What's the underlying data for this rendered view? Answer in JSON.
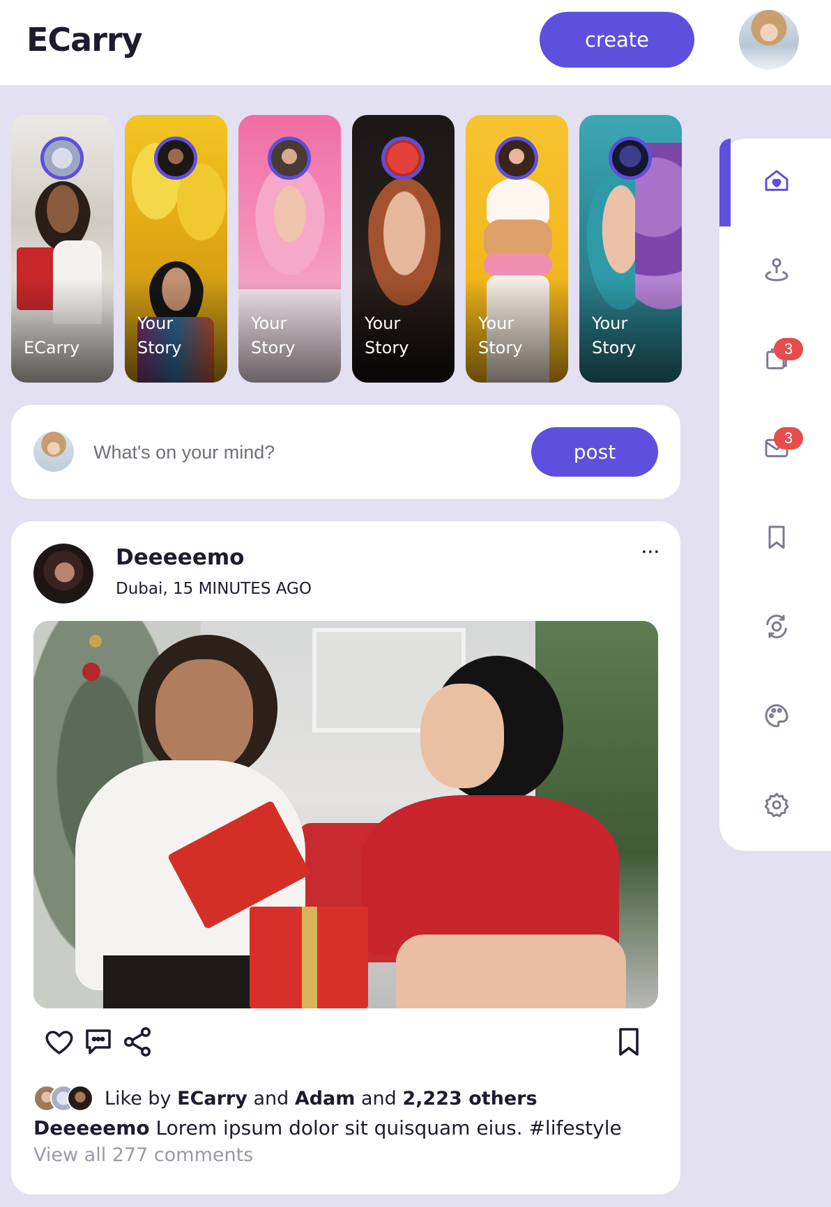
{
  "header": {
    "brand": "ECarry",
    "create_label": "create"
  },
  "stories": [
    {
      "label": "ECarry"
    },
    {
      "label": "Your\nStory"
    },
    {
      "label": "Your\nStory"
    },
    {
      "label": "Your\nStory"
    },
    {
      "label": "Your\nStory"
    },
    {
      "label": "Your\nStory"
    }
  ],
  "composer": {
    "placeholder": "What's on your mind?",
    "post_label": "post"
  },
  "post": {
    "author": "Deeeeemo",
    "meta": "Dubai, 15 MINUTES AGO",
    "more": "···",
    "likes": {
      "prefix": "Like by",
      "user1": "ECarry",
      "and1": "and",
      "user2": "Adam",
      "and2": "and",
      "others": "2,223 others"
    },
    "caption_author": "Deeeeemo",
    "caption_text": "Lorem ipsum dolor sit quisquam eius. #lifestyle",
    "comments_link": "View all 277 comments"
  },
  "sidenav": {
    "items": [
      {
        "icon": "home-heart-icon",
        "active": true
      },
      {
        "icon": "location-pin-icon"
      },
      {
        "icon": "notification-icon",
        "badge": "3"
      },
      {
        "icon": "mail-icon",
        "badge": "3"
      },
      {
        "icon": "bookmark-icon"
      },
      {
        "icon": "explore-icon"
      },
      {
        "icon": "palette-icon"
      },
      {
        "icon": "gear-icon"
      }
    ]
  },
  "colors": {
    "accent": "#5e4fdc",
    "background": "#e2e0f1",
    "badge": "#e74c4c"
  }
}
